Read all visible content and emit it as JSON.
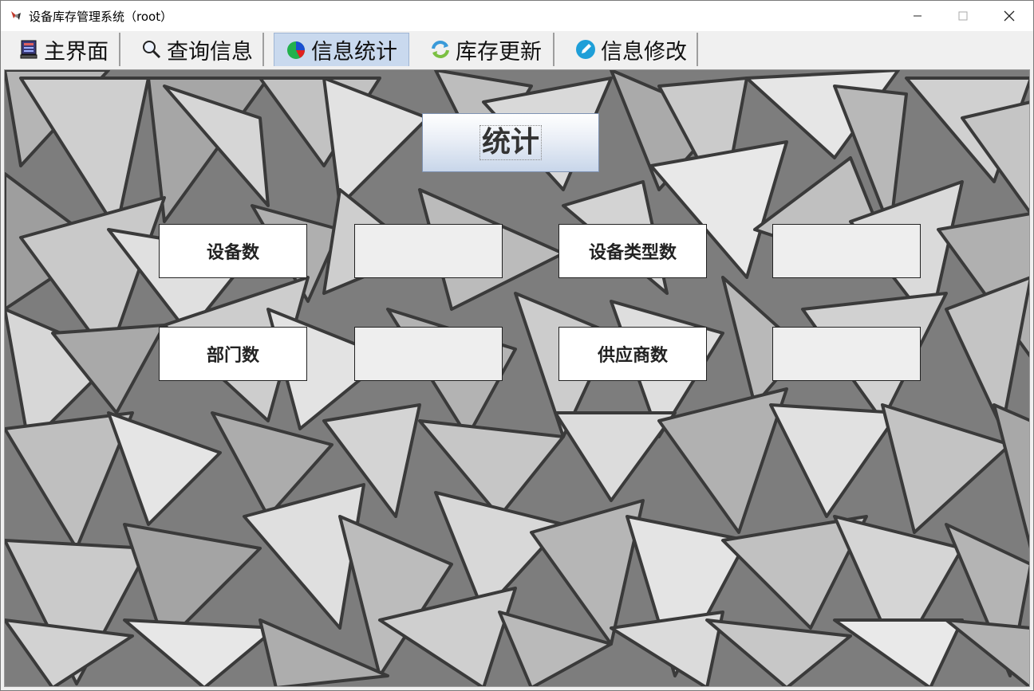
{
  "window": {
    "title": "设备库存管理系统（root）",
    "controls": {
      "minimize_icon": "minimize-icon",
      "maximize_icon": "maximize-icon",
      "close_icon": "close-icon"
    }
  },
  "tabs": [
    {
      "label": "主界面",
      "icon": "monitor-icon",
      "active": false
    },
    {
      "label": "查询信息",
      "icon": "magnifier-icon",
      "active": false
    },
    {
      "label": "信息统计",
      "icon": "pie-chart-icon",
      "active": true
    },
    {
      "label": "库存更新",
      "icon": "refresh-icon",
      "active": false
    },
    {
      "label": "信息修改",
      "icon": "edit-icon",
      "active": false
    }
  ],
  "stats": {
    "button_label": "统计",
    "rows": [
      {
        "label": "设备数",
        "value": ""
      },
      {
        "label": "设备类型数",
        "value": ""
      },
      {
        "label": "部门数",
        "value": ""
      },
      {
        "label": "供应商数",
        "value": ""
      }
    ]
  },
  "colors": {
    "active_tab": "#c9d9ee",
    "button_gradient_bottom": "#c8d6ea",
    "value_box": "#eeeeee"
  }
}
